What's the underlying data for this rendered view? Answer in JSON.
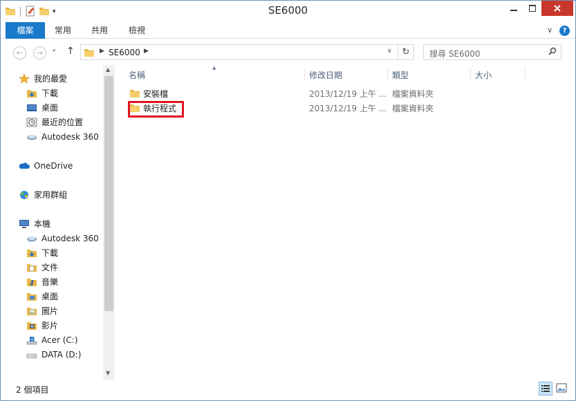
{
  "window": {
    "title": "SE6000",
    "colors": {
      "accent": "#1979ca",
      "close": "#c8372b",
      "highlight_box": "#e0141e",
      "folder": "#e8b84a"
    }
  },
  "ribbon": {
    "tabs": [
      "檔案",
      "常用",
      "共用",
      "檢視"
    ]
  },
  "address": {
    "crumbs": [
      "SE6000"
    ],
    "search_placeholder": "搜尋 SE6000"
  },
  "navpane": {
    "favorites_header": "我的最愛",
    "favorites": [
      "下載",
      "桌面",
      "最近的位置",
      "Autodesk 360"
    ],
    "onedrive": "OneDrive",
    "homegroup": "家用群組",
    "thispc_header": "本機",
    "thispc": [
      "Autodesk 360",
      "下載",
      "文件",
      "音樂",
      "桌面",
      "圖片",
      "影片",
      "Acer (C:)",
      "DATA (D:)"
    ]
  },
  "content": {
    "columns": [
      "名稱",
      "修改日期",
      "類型",
      "大小"
    ],
    "rows": [
      {
        "name": "安裝檔",
        "date": "2013/12/19 上午 ...",
        "type": "檔案資料夾"
      },
      {
        "name": "執行程式",
        "date": "2013/12/19 上午 ...",
        "type": "檔案資料夾"
      }
    ]
  },
  "status": {
    "item_count": "2 個項目"
  }
}
